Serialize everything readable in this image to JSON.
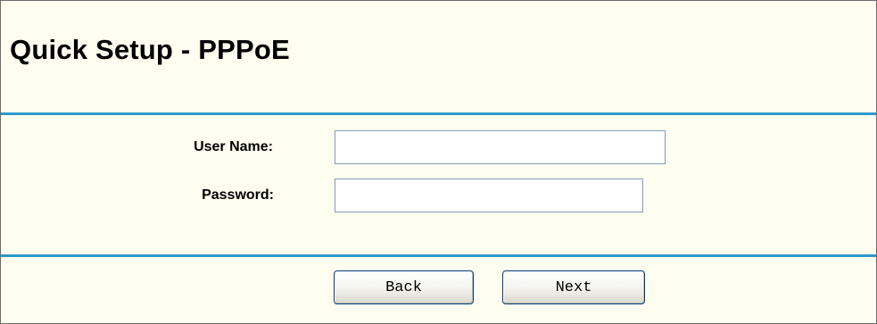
{
  "page": {
    "title": "Quick Setup - PPPoE"
  },
  "form": {
    "user_name_label": "User Name:",
    "user_name_value": "",
    "password_label": "Password:",
    "password_value": ""
  },
  "actions": {
    "back_label": "Back",
    "next_label": "Next"
  },
  "colors": {
    "background": "#fdfdf0",
    "rule": "#2e99c9",
    "input_border": "#7f9db9",
    "button_border": "#003c74"
  }
}
